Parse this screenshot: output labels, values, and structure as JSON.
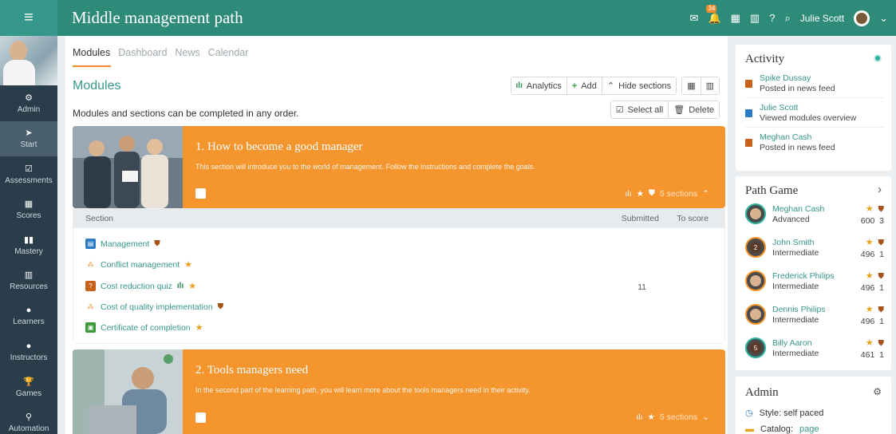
{
  "header": {
    "title": "Middle management path",
    "notification_count": "34",
    "user_name": "Julie Scott"
  },
  "sidebar": {
    "items": [
      {
        "label": "Admin",
        "icon": "gear-icon"
      },
      {
        "label": "Start",
        "icon": "send-icon"
      },
      {
        "label": "Assessments",
        "icon": "checkbox-icon"
      },
      {
        "label": "Scores",
        "icon": "table-icon"
      },
      {
        "label": "Mastery",
        "icon": "bar-chart-icon"
      },
      {
        "label": "Resources",
        "icon": "books-icon"
      },
      {
        "label": "Learners",
        "icon": "user-icon"
      },
      {
        "label": "Instructors",
        "icon": "instructor-icon"
      },
      {
        "label": "Games",
        "icon": "trophy-icon"
      },
      {
        "label": "Automation",
        "icon": "automation-icon"
      }
    ]
  },
  "tabs": [
    "Modules",
    "Dashboard",
    "News",
    "Calendar"
  ],
  "main": {
    "heading": "Modules",
    "description": "Modules and sections can be completed in any order.",
    "analytics_label": "Analytics",
    "add_label": "Add",
    "hide_sections_label": "Hide sections",
    "select_all_label": "Select all",
    "delete_label": "Delete"
  },
  "sections": [
    {
      "title": "1. How to become a good manager",
      "description": "This section will introduce you to the world of management. Follow the instructions and complete the goals.",
      "count": "5 sections"
    },
    {
      "title": "2. Tools managers need",
      "description": "In the second part of the learning path, you will learn more about the tools managers need in their activity.",
      "count": "5 sections"
    }
  ],
  "table": {
    "col_section": "Section",
    "col_submitted": "Submitted",
    "col_to_score": "To score",
    "rows": [
      {
        "name": "Management",
        "submitted": ""
      },
      {
        "name": "Conflict management",
        "submitted": ""
      },
      {
        "name": "Cost reduction quiz",
        "submitted": "11"
      },
      {
        "name": "Cost of quality implementation",
        "submitted": ""
      },
      {
        "name": "Certificate of completion",
        "submitted": ""
      }
    ]
  },
  "activity": {
    "title": "Activity",
    "items": [
      {
        "name": "Spike Dussay",
        "text": "Posted in news feed"
      },
      {
        "name": "Julie Scott",
        "text": "Viewed modules overview"
      },
      {
        "name": "Meghan Cash",
        "text": "Posted in news feed"
      }
    ]
  },
  "path_game": {
    "title": "Path Game",
    "players": [
      {
        "name": "Meghan Cash",
        "level": "Advanced",
        "points": "600",
        "badges": "3",
        "avatar_text": ""
      },
      {
        "name": "John Smith",
        "level": "Intermediate",
        "points": "496",
        "badges": "1",
        "avatar_text": "2"
      },
      {
        "name": "Frederick Philips",
        "level": "Intermediate",
        "points": "496",
        "badges": "1",
        "avatar_text": ""
      },
      {
        "name": "Dennis Philips",
        "level": "Intermediate",
        "points": "496",
        "badges": "1",
        "avatar_text": ""
      },
      {
        "name": "Billy Aaron",
        "level": "Intermediate",
        "points": "461",
        "badges": "1",
        "avatar_text": "5"
      }
    ]
  },
  "admin_panel": {
    "title": "Admin",
    "style_label": "Style: self paced",
    "catalog_label": "Catalog:",
    "catalog_value": "page"
  },
  "colors": {
    "header": "#2e8b7a",
    "sidebar": "#2a3d4a",
    "section_orange": "#f4952d",
    "accent_teal": "#35968a"
  }
}
